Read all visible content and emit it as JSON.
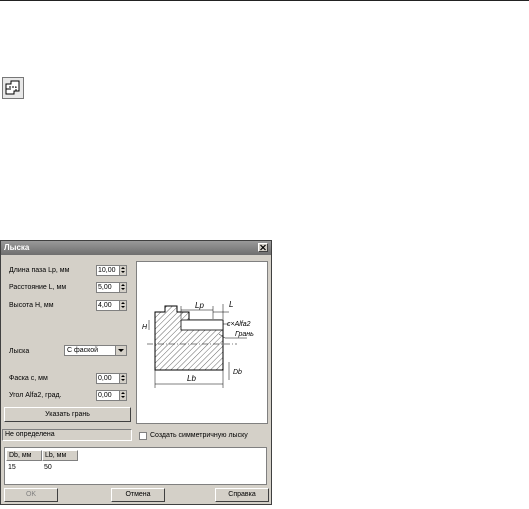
{
  "dialog": {
    "title": "Лыска",
    "fields": {
      "slot_length_label": "Длина паза Lр, мм",
      "slot_length_value": "10,00",
      "distance_label": "Расстояние L, мм",
      "distance_value": "5,00",
      "height_label": "Высота H, мм",
      "height_value": "4,00",
      "flat_label": "Лыска",
      "flat_value": "С фаской",
      "chamfer_label": "Фаска с, мм",
      "chamfer_value": "0,00",
      "angle_label": "Угол Alfa2, град.",
      "angle_value": "0,00"
    },
    "select_face_button": "Указать грань",
    "status_text": "Не определена",
    "symmetric_checkbox_label": "Создать симметричную лыску",
    "symmetric_checked": false,
    "table": {
      "columns": [
        "Db, мм",
        "Lb, мм"
      ],
      "rows": [
        [
          "15",
          "50"
        ]
      ]
    },
    "ok_button": "OK",
    "cancel_button": "Отмена",
    "help_button": "Справка",
    "drawing_labels": {
      "lp": "Lр",
      "l": "L",
      "calfa": "c×Alfa2",
      "face": "Грань",
      "h": "H",
      "lb": "Lb",
      "db": "Db"
    }
  },
  "toolbar_icon": "flat-tool-icon"
}
